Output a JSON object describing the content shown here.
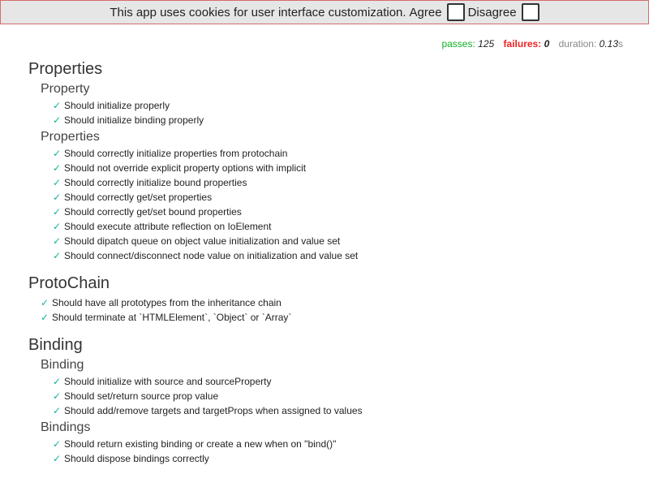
{
  "cookie_banner": {
    "text": "This app uses cookies for user interface customization.",
    "agree_label": "Agree",
    "disagree_label": "Disagree"
  },
  "stats": {
    "passes_label": "passes:",
    "passes_value": "125",
    "failures_label": "failures:",
    "failures_value": "0",
    "duration_label": "duration:",
    "duration_value": "0.13",
    "duration_unit": "s"
  },
  "suites": [
    {
      "title": "Properties",
      "subsuites": [
        {
          "title": "Property",
          "tests": [
            "Should initialize properly",
            "Should initialize binding properly"
          ]
        },
        {
          "title": "Properties",
          "tests": [
            "Should correctly initialize properties from protochain",
            "Should not override explicit property options with implicit",
            "Should correctly initialize bound properties",
            "Should correctly get/set properties",
            "Should correctly get/set bound properties",
            "Should execute attribute reflection on IoElement",
            "Should dipatch queue on object value initialization and value set",
            "Should connect/disconnect node value on initialization and value set"
          ]
        }
      ]
    },
    {
      "title": "ProtoChain",
      "tests": [
        "Should have all prototypes from the inheritance chain",
        "Should terminate at `HTMLElement`, `Object` or `Array`"
      ]
    },
    {
      "title": "Binding",
      "subsuites": [
        {
          "title": "Binding",
          "tests": [
            "Should initialize with source and sourceProperty",
            "Should set/return source prop value",
            "Should add/remove targets and targetProps when assigned to values"
          ]
        },
        {
          "title": "Bindings",
          "tests": [
            "Should return existing binding or create a new when on \"bind()\"",
            "Should dispose bindings correctly"
          ]
        }
      ]
    }
  ],
  "icons": {
    "pass": "check-icon"
  },
  "colors": {
    "passes": "#11b026",
    "failures": "#ee2222",
    "check": "#12b59a",
    "banner_border": "#d76b6b"
  }
}
